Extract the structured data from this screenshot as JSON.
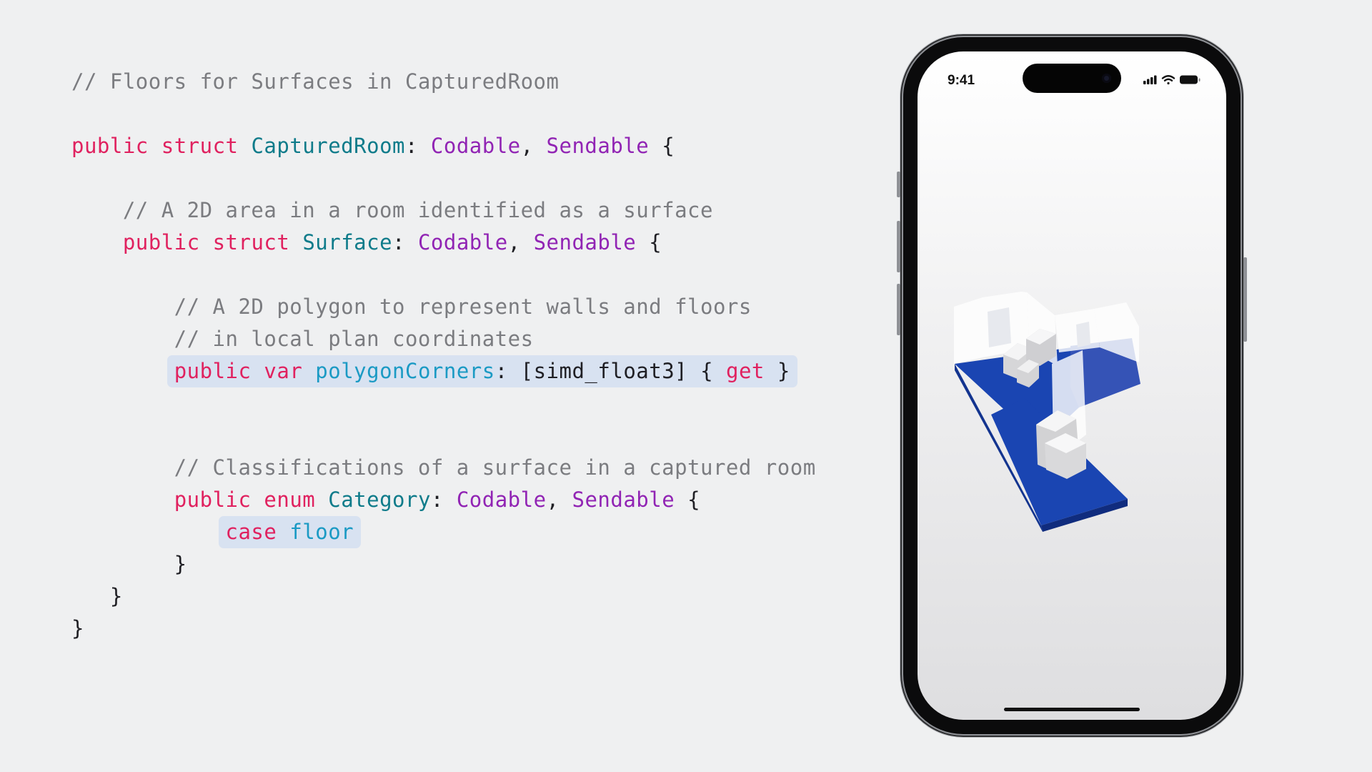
{
  "code": {
    "lines": [
      {
        "hl": null,
        "tokens": [
          {
            "text": "// Floors for Surfaces in CapturedRoom",
            "kind": "comment"
          }
        ]
      },
      {
        "hl": null,
        "tokens": []
      },
      {
        "hl": null,
        "tokens": [
          {
            "text": "public",
            "kind": "keyword"
          },
          {
            "text": " ",
            "kind": "plain"
          },
          {
            "text": "struct",
            "kind": "keyword"
          },
          {
            "text": " ",
            "kind": "plain"
          },
          {
            "text": "CapturedRoom",
            "kind": "type"
          },
          {
            "text": ": ",
            "kind": "plain"
          },
          {
            "text": "Codable",
            "kind": "proto"
          },
          {
            "text": ", ",
            "kind": "plain"
          },
          {
            "text": "Sendable",
            "kind": "proto"
          },
          {
            "text": " {",
            "kind": "plain"
          }
        ]
      },
      {
        "hl": null,
        "tokens": []
      },
      {
        "hl": null,
        "tokens": [
          {
            "text": "    // A 2D area in a room identified as a surface",
            "kind": "comment"
          }
        ]
      },
      {
        "hl": null,
        "tokens": [
          {
            "text": "    ",
            "kind": "plain"
          },
          {
            "text": "public",
            "kind": "keyword"
          },
          {
            "text": " ",
            "kind": "plain"
          },
          {
            "text": "struct",
            "kind": "keyword"
          },
          {
            "text": " ",
            "kind": "plain"
          },
          {
            "text": "Surface",
            "kind": "type"
          },
          {
            "text": ": ",
            "kind": "plain"
          },
          {
            "text": "Codable",
            "kind": "proto"
          },
          {
            "text": ", ",
            "kind": "plain"
          },
          {
            "text": "Sendable",
            "kind": "proto"
          },
          {
            "text": " {",
            "kind": "plain"
          }
        ]
      },
      {
        "hl": null,
        "tokens": []
      },
      {
        "hl": null,
        "tokens": [
          {
            "text": "        // A 2D polygon to represent walls and floors",
            "kind": "comment"
          }
        ]
      },
      {
        "hl": null,
        "tokens": [
          {
            "text": "        // in local plan coordinates",
            "kind": "comment"
          }
        ]
      },
      {
        "hl": "polygonCorners",
        "tokens": [
          {
            "text": "        ",
            "kind": "plain"
          },
          {
            "text": "public",
            "kind": "keyword"
          },
          {
            "text": " ",
            "kind": "plain"
          },
          {
            "text": "var",
            "kind": "keyword"
          },
          {
            "text": " ",
            "kind": "plain"
          },
          {
            "text": "polygonCorners",
            "kind": "prop"
          },
          {
            "text": ": [simd_float3] { ",
            "kind": "plain"
          },
          {
            "text": "get",
            "kind": "keyword"
          },
          {
            "text": " }",
            "kind": "plain"
          }
        ]
      },
      {
        "hl": null,
        "tokens": []
      },
      {
        "hl": null,
        "tokens": []
      },
      {
        "hl": null,
        "tokens": [
          {
            "text": "        // Classifications of a surface in a captured room",
            "kind": "comment"
          }
        ]
      },
      {
        "hl": null,
        "tokens": [
          {
            "text": "        ",
            "kind": "plain"
          },
          {
            "text": "public",
            "kind": "keyword"
          },
          {
            "text": " ",
            "kind": "plain"
          },
          {
            "text": "enum",
            "kind": "keyword"
          },
          {
            "text": " ",
            "kind": "plain"
          },
          {
            "text": "Category",
            "kind": "type"
          },
          {
            "text": ": ",
            "kind": "plain"
          },
          {
            "text": "Codable",
            "kind": "proto"
          },
          {
            "text": ", ",
            "kind": "plain"
          },
          {
            "text": "Sendable",
            "kind": "proto"
          },
          {
            "text": " {",
            "kind": "plain"
          }
        ]
      },
      {
        "hl": "case-floor",
        "tokens": [
          {
            "text": "            ",
            "kind": "plain"
          },
          {
            "text": "case",
            "kind": "keyword"
          },
          {
            "text": " ",
            "kind": "plain"
          },
          {
            "text": "floor",
            "kind": "prop"
          }
        ]
      },
      {
        "hl": null,
        "tokens": [
          {
            "text": "        }",
            "kind": "plain"
          }
        ]
      },
      {
        "hl": null,
        "tokens": [
          {
            "text": "   }",
            "kind": "plain"
          }
        ]
      },
      {
        "hl": null,
        "tokens": [
          {
            "text": "}",
            "kind": "plain"
          }
        ]
      }
    ]
  },
  "phone": {
    "status_time": "9:41",
    "status_icons": [
      "cellular-signal-icon",
      "wifi-icon",
      "battery-icon"
    ],
    "scene": "room-3d-floor-model"
  },
  "colors": {
    "background": "#eff0f1",
    "comment": "#7b7c80",
    "keyword": "#e0215f",
    "type": "#0e7b8a",
    "proto": "#9124b4",
    "prop": "#1b9ac4",
    "highlight": "#d8e2f1",
    "floor": "#1a45b2"
  }
}
